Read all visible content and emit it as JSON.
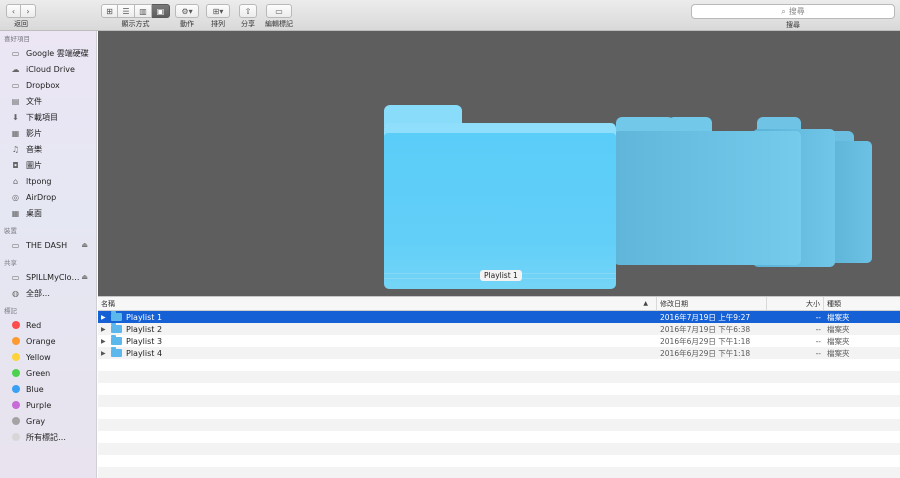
{
  "toolbar": {
    "back_label": "返回",
    "view_label": "顯示方式",
    "action_label": "動作",
    "arrange_label": "排列",
    "share_label": "分享",
    "edit_tags_label": "編輯標記",
    "search_placeholder": "搜尋",
    "search_label": "搜尋"
  },
  "sidebar": {
    "favorites_header": "喜好項目",
    "favorites": [
      {
        "label": "Google 雲端硬碟",
        "icon": "folder-icon"
      },
      {
        "label": "iCloud Drive",
        "icon": "cloud-icon"
      },
      {
        "label": "Dropbox",
        "icon": "folder-icon"
      },
      {
        "label": "文件",
        "icon": "document-icon"
      },
      {
        "label": "下載項目",
        "icon": "download-icon"
      },
      {
        "label": "影片",
        "icon": "film-icon"
      },
      {
        "label": "音樂",
        "icon": "music-icon"
      },
      {
        "label": "圖片",
        "icon": "camera-icon"
      },
      {
        "label": "ltpong",
        "icon": "home-icon"
      },
      {
        "label": "AirDrop",
        "icon": "airdrop-icon"
      },
      {
        "label": "桌面",
        "icon": "desktop-icon"
      }
    ],
    "devices_header": "裝置",
    "devices": [
      {
        "label": "THE DASH",
        "icon": "disk-icon"
      }
    ],
    "shared_header": "共享",
    "shared": [
      {
        "label": "SPILLMyClo…",
        "icon": "display-icon"
      },
      {
        "label": "全部…",
        "icon": "globe-icon"
      }
    ],
    "tags_header": "標記",
    "tags": [
      {
        "label": "Red",
        "color": "#fc4c4c"
      },
      {
        "label": "Orange",
        "color": "#fd9a32"
      },
      {
        "label": "Yellow",
        "color": "#fdd23a"
      },
      {
        "label": "Green",
        "color": "#4ed14e"
      },
      {
        "label": "Blue",
        "color": "#3aa0f5"
      },
      {
        "label": "Purple",
        "color": "#c86ad8"
      },
      {
        "label": "Gray",
        "color": "#a4a4a4"
      },
      {
        "label": "所有標記…",
        "color": "#d7d7d7"
      }
    ]
  },
  "preview": {
    "caption": "Playlist 1"
  },
  "list": {
    "columns": {
      "name": "名稱",
      "date": "修改日期",
      "size": "大小",
      "kind": "種類"
    },
    "rows": [
      {
        "name": "Playlist 1",
        "date": "2016年7月19日 上午9:27",
        "size": "--",
        "kind": "檔案夾",
        "selected": true
      },
      {
        "name": "Playlist 2",
        "date": "2016年7月19日 下午6:38",
        "size": "--",
        "kind": "檔案夾",
        "selected": false
      },
      {
        "name": "Playlist 3",
        "date": "2016年6月29日 下午1:18",
        "size": "--",
        "kind": "檔案夾",
        "selected": false
      },
      {
        "name": "Playlist 4",
        "date": "2016年6月29日 下午1:18",
        "size": "--",
        "kind": "檔案夾",
        "selected": false
      }
    ]
  },
  "colors": {
    "selection": "#1660d6",
    "folder_front": "#5ccff8",
    "folder_back": "#5fb8dc",
    "preview_bg": "#5e5e5e"
  }
}
